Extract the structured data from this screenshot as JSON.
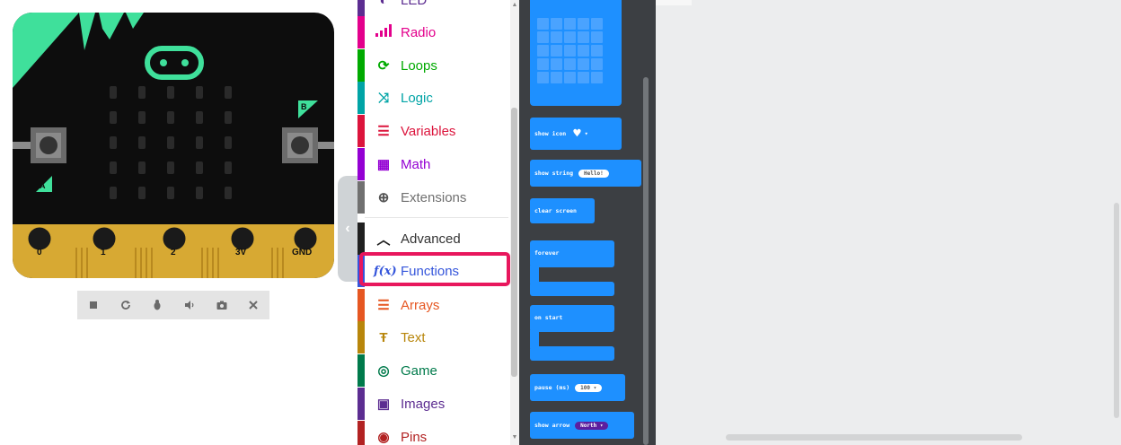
{
  "simulator": {
    "pins": [
      "0",
      "1",
      "2",
      "3V",
      "GND"
    ],
    "button_a": "A",
    "button_b": "B",
    "controls": [
      {
        "name": "stop-button",
        "icon": "stop-icon"
      },
      {
        "name": "restart-button",
        "icon": "restart-icon"
      },
      {
        "name": "debug-button",
        "icon": "bug-icon"
      },
      {
        "name": "mute-button",
        "icon": "speaker-icon"
      },
      {
        "name": "screenshot-button",
        "icon": "camera-icon"
      },
      {
        "name": "fullscreen-button",
        "icon": "close-icon"
      }
    ]
  },
  "toolbox": {
    "items": [
      {
        "label": "LED",
        "color": "#5c2d91",
        "icon": "led-icon"
      },
      {
        "label": "Radio",
        "color": "#e3008c",
        "icon": "radio-icon"
      },
      {
        "label": "Loops",
        "color": "#00aa00",
        "icon": "loops-icon"
      },
      {
        "label": "Logic",
        "color": "#00a4a6",
        "icon": "logic-icon"
      },
      {
        "label": "Variables",
        "color": "#dc143c",
        "icon": "variables-icon"
      },
      {
        "label": "Math",
        "color": "#9400d3",
        "icon": "math-icon"
      },
      {
        "label": "Extensions",
        "color": "#707070",
        "icon": "extensions-icon"
      },
      {
        "label": "Advanced",
        "color": "#202020",
        "icon": "chevron-up-icon"
      },
      {
        "label": "Functions",
        "color": "#3455db",
        "icon": "functions-icon"
      },
      {
        "label": "Arrays",
        "color": "#e65722",
        "icon": "arrays-icon"
      },
      {
        "label": "Text",
        "color": "#b8860b",
        "icon": "text-icon"
      },
      {
        "label": "Game",
        "color": "#007a4b",
        "icon": "game-icon"
      },
      {
        "label": "Images",
        "color": "#5c2d91",
        "icon": "images-icon"
      },
      {
        "label": "Pins",
        "color": "#b22222",
        "icon": "pins-icon"
      }
    ],
    "highlighted": "Functions",
    "highlight_color": "#e8175d"
  },
  "flyout": {
    "blocks": {
      "show_icon": "show icon",
      "show_string": "show string",
      "show_string_value": "Hello!",
      "clear_screen": "clear screen",
      "forever": "forever",
      "on_start": "on start",
      "pause": "pause (ms)",
      "pause_value": "100",
      "show_arrow": "show arrow",
      "show_arrow_value": "North"
    },
    "block_color": "#1e90ff"
  }
}
